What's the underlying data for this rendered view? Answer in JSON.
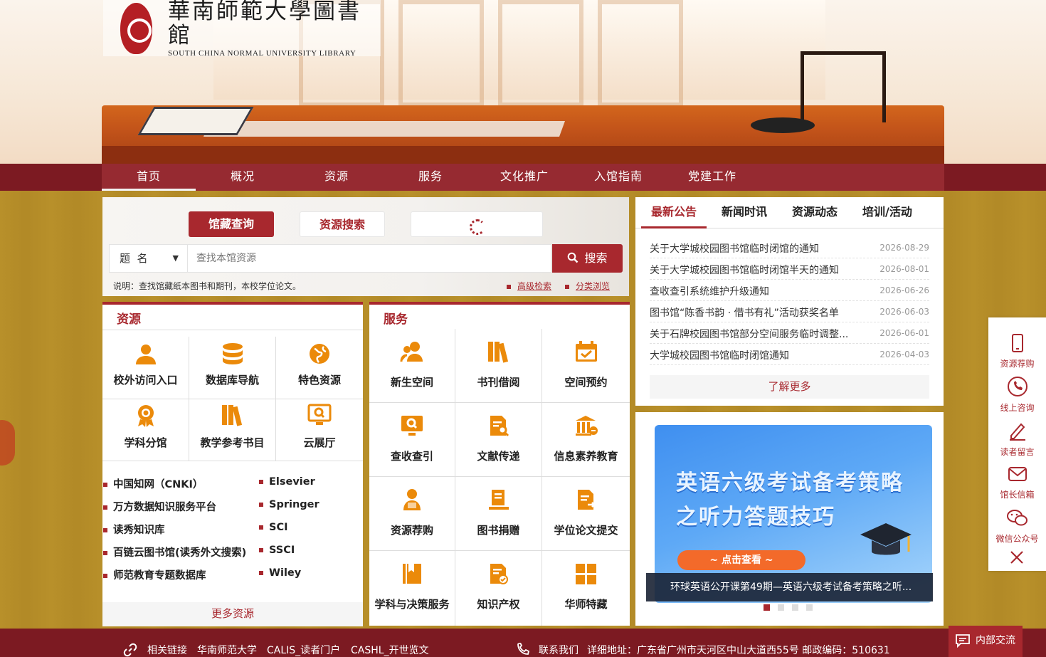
{
  "header": {
    "logo_cn": "華南師範大學圖書館",
    "logo_en": "SOUTH CHINA NORMAL UNIVERSITY LIBRARY"
  },
  "nav": {
    "items": [
      {
        "label": "首页"
      },
      {
        "label": "概况"
      },
      {
        "label": "资源"
      },
      {
        "label": "服务"
      },
      {
        "label": "文化推广"
      },
      {
        "label": "入馆指南"
      },
      {
        "label": "党建工作"
      }
    ]
  },
  "search": {
    "tabs": [
      {
        "label": "馆藏查询"
      },
      {
        "label": "资源搜索"
      }
    ],
    "field_selected": "题  名",
    "placeholder": "查找本馆资源",
    "button": "搜索",
    "note": "说明：查找馆藏纸本图书和期刊，本校学位论文。",
    "links": [
      {
        "label": "高级检索"
      },
      {
        "label": "分类浏览"
      }
    ]
  },
  "resources": {
    "title": "资源",
    "tiles": [
      {
        "label": "校外访问入口",
        "icon": "user-icon"
      },
      {
        "label": "数据库导航",
        "icon": "database-icon"
      },
      {
        "label": "特色资源",
        "icon": "globe-icon"
      },
      {
        "label": "学科分馆",
        "icon": "badge-icon"
      },
      {
        "label": "教学参考书目",
        "icon": "books-icon"
      },
      {
        "label": "云展厅",
        "icon": "monitor-icon"
      }
    ],
    "databases": [
      {
        "label": "中国知网（CNKI）"
      },
      {
        "label": "Elsevier"
      },
      {
        "label": "万方数据知识服务平台"
      },
      {
        "label": "Springer"
      },
      {
        "label": "读秀知识库"
      },
      {
        "label": "SCI"
      },
      {
        "label": "百链云图书馆(读秀外文搜索)"
      },
      {
        "label": "SSCI"
      },
      {
        "label": "师范教育专题数据库"
      },
      {
        "label": "Wiley"
      }
    ],
    "more": "更多资源"
  },
  "services": {
    "title": "服务",
    "tiles": [
      {
        "label": "新生空间",
        "icon": "users-icon"
      },
      {
        "label": "书刊借阅",
        "icon": "books-icon"
      },
      {
        "label": "空间预约",
        "icon": "calendar-icon"
      },
      {
        "label": "查收查引",
        "icon": "search-monitor-icon"
      },
      {
        "label": "文献传递",
        "icon": "document-search-icon"
      },
      {
        "label": "信息素养教育",
        "icon": "institution-icon"
      },
      {
        "label": "资源荐购",
        "icon": "person-icon"
      },
      {
        "label": "图书捐赠",
        "icon": "book-donate-icon"
      },
      {
        "label": "学位论文提交",
        "icon": "document-submit-icon"
      },
      {
        "label": "学科与决策服务",
        "icon": "bookmark-icon"
      },
      {
        "label": "知识产权",
        "icon": "document-check-icon"
      },
      {
        "label": "华师特藏",
        "icon": "grid-icon"
      }
    ]
  },
  "news": {
    "tabs": [
      {
        "label": "最新公告"
      },
      {
        "label": "新闻时讯"
      },
      {
        "label": "资源动态"
      },
      {
        "label": "培训/活动"
      }
    ],
    "items": [
      {
        "title": "关于大学城校园图书馆临时闭馆的通知",
        "date": "2026-08-29"
      },
      {
        "title": "关于大学城校园图书馆临时闭馆半天的通知",
        "date": "2026-08-01"
      },
      {
        "title": "查收查引系统维护升级通知",
        "date": "2026-06-26"
      },
      {
        "title": "图书馆“陈香书韵 · 借书有礼”活动获奖名单",
        "date": "2026-06-03"
      },
      {
        "title": "关于石牌校园图书馆部分空间服务临时调整...",
        "date": "2026-06-01"
      },
      {
        "title": "大学城校园图书馆临时闭馆通知",
        "date": "2026-04-03"
      }
    ],
    "more": "了解更多"
  },
  "banner": {
    "headline1": "英语六级考试备考策略",
    "headline2": "之听力答题技巧",
    "cta": "~ 点击查看 ~",
    "caption": "环球英语公开课第49期—英语六级考试备考策略之听...",
    "slide_count": 4,
    "active_slide": 1
  },
  "sidebar": {
    "items": [
      {
        "label": "资源荐购",
        "icon": "phone-icon"
      },
      {
        "label": "线上咨询",
        "icon": "call-icon"
      },
      {
        "label": "读者留言",
        "icon": "pen-icon"
      },
      {
        "label": "馆长信箱",
        "icon": "mail-icon"
      },
      {
        "label": "微信公众号",
        "icon": "wechat-icon"
      }
    ]
  },
  "footer": {
    "links_label": "相关链接",
    "links": [
      {
        "label": "华南师范大学"
      },
      {
        "label": "CALIS_读者门户"
      },
      {
        "label": "CASHL_开世览文"
      }
    ],
    "contact_label": "联系我们",
    "address": "详细地址：广东省广州市天河区中山大道西55号 邮政编码：510631",
    "chat_button": "内部交流"
  },
  "colors": {
    "brand": "#a8282e",
    "nav": "#962a31",
    "accent_icon": "#eb8a0a",
    "background": "#b8902a"
  }
}
